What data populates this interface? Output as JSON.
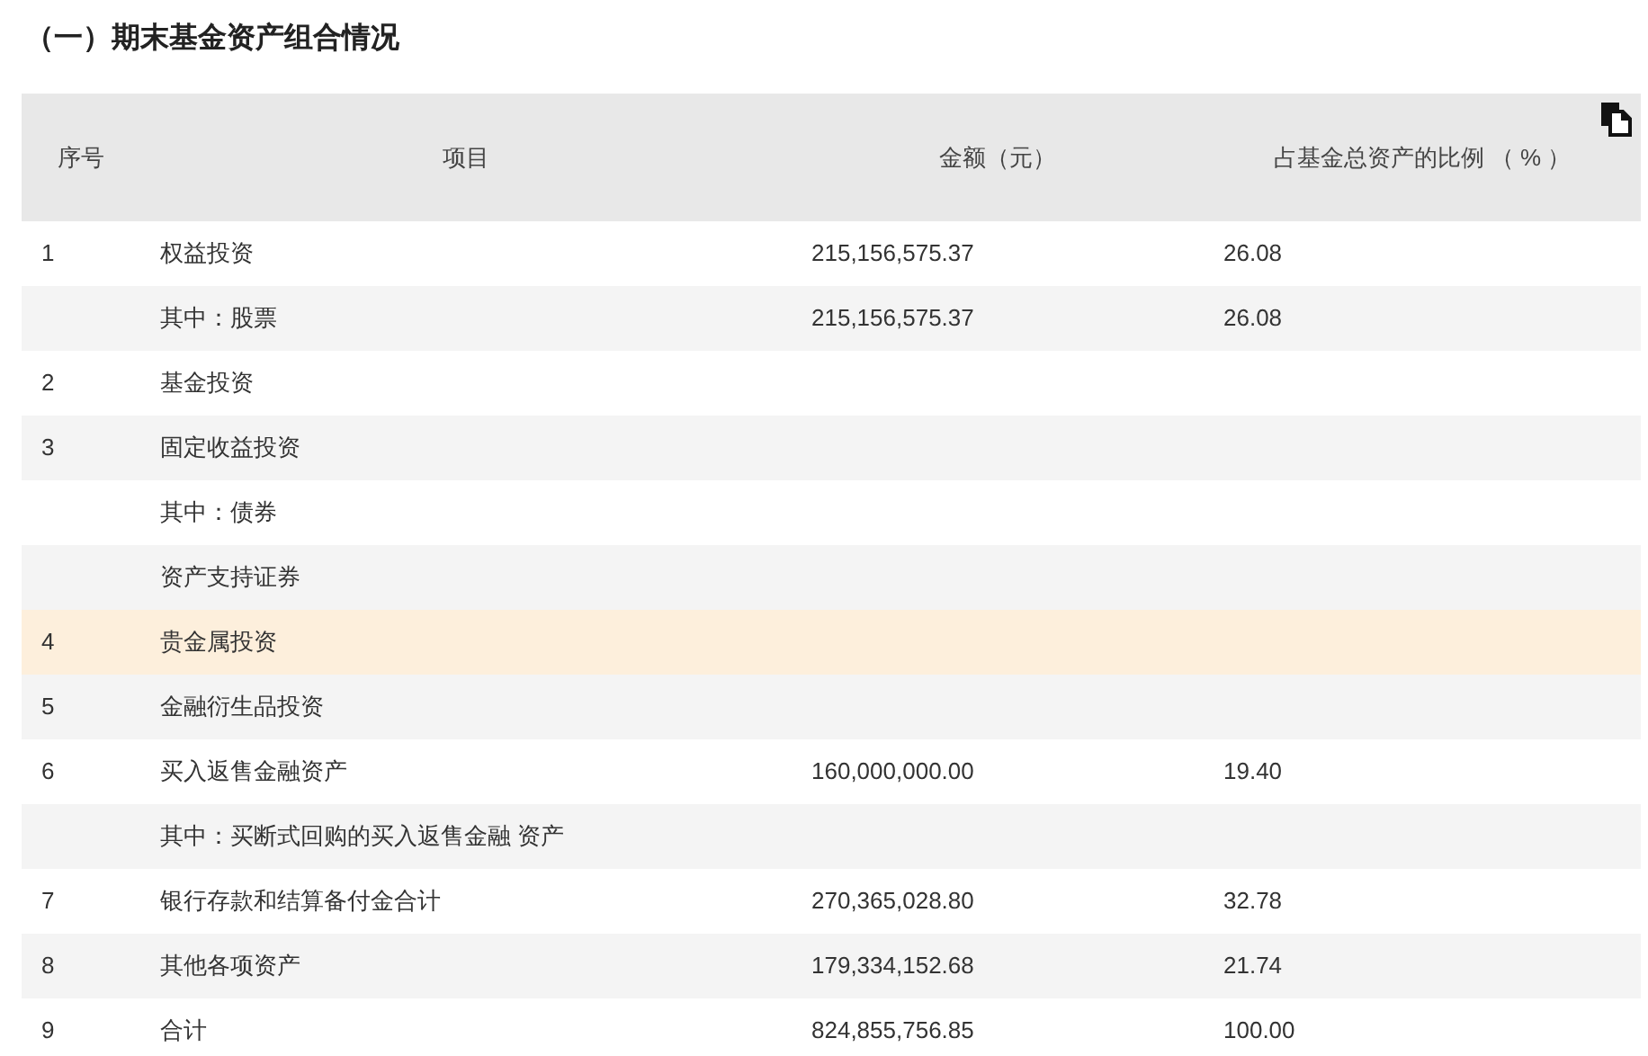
{
  "title": "（一）期末基金资产组合情况",
  "table": {
    "columns": [
      "序号",
      "项目",
      "金额（元）",
      "占基金总资产的比例 （ % ）"
    ],
    "rows": [
      {
        "cells": [
          "1",
          "权益投资",
          "215,156,575.37",
          "26.08"
        ],
        "selected": false
      },
      {
        "cells": [
          "",
          "其中：股票",
          "215,156,575.37",
          "26.08"
        ],
        "selected": false
      },
      {
        "cells": [
          "2",
          "基金投资",
          "",
          ""
        ],
        "selected": false
      },
      {
        "cells": [
          "3",
          "固定收益投资",
          "",
          ""
        ],
        "selected": false
      },
      {
        "cells": [
          "",
          "其中：债券",
          "",
          ""
        ],
        "selected": false
      },
      {
        "cells": [
          "",
          "资产支持证券",
          "",
          ""
        ],
        "selected": false
      },
      {
        "cells": [
          "4",
          "贵金属投资",
          "",
          ""
        ],
        "selected": true
      },
      {
        "cells": [
          "5",
          "金融衍生品投资",
          "",
          ""
        ],
        "selected": false
      },
      {
        "cells": [
          "6",
          "买入返售金融资产",
          "160,000,000.00",
          "19.40"
        ],
        "selected": false
      },
      {
        "cells": [
          "",
          "其中：买断式回购的买入返售金融 资产",
          "",
          ""
        ],
        "selected": false
      },
      {
        "cells": [
          "7",
          "银行存款和结算备付金合计",
          "270,365,028.80",
          "32.78"
        ],
        "selected": false
      },
      {
        "cells": [
          "8",
          "其他各项资产",
          "179,334,152.68",
          "21.74"
        ],
        "selected": false
      },
      {
        "cells": [
          "9",
          "合计",
          "824,855,756.85",
          "100.00"
        ],
        "selected": false
      }
    ]
  }
}
